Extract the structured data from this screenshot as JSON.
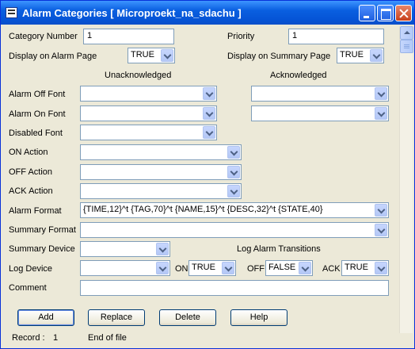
{
  "window": {
    "title": "Alarm Categories [ Microproekt_na_sdachu ]"
  },
  "form": {
    "category_number": {
      "label": "Category Number",
      "value": "1"
    },
    "priority": {
      "label": "Priority",
      "value": "1"
    },
    "display_on_alarm_page": {
      "label": "Display on Alarm Page",
      "value": "TRUE"
    },
    "display_on_summary_page": {
      "label": "Display on Summary Page",
      "value": "TRUE"
    },
    "headers": {
      "unacknowledged": "Unacknowledged",
      "acknowledged": "Acknowledged"
    },
    "alarm_off_font": {
      "label": "Alarm Off Font",
      "unack": "",
      "ack": ""
    },
    "alarm_on_font": {
      "label": "Alarm On Font",
      "unack": "",
      "ack": ""
    },
    "disabled_font": {
      "label": "Disabled Font",
      "value": ""
    },
    "on_action": {
      "label": "ON Action",
      "value": ""
    },
    "off_action": {
      "label": "OFF Action",
      "value": ""
    },
    "ack_action": {
      "label": "ACK Action",
      "value": ""
    },
    "alarm_format": {
      "label": "Alarm Format",
      "value": "{TIME,12}^t {TAG,70}^t {NAME,15}^t {DESC,32}^t {STATE,40}"
    },
    "summary_format": {
      "label": "Summary Format",
      "value": ""
    },
    "summary_device": {
      "label": "Summary Device",
      "value": ""
    },
    "log_alarm_transitions": {
      "label": "Log Alarm Transitions"
    },
    "log_device": {
      "label": "Log Device",
      "value": ""
    },
    "log_on": {
      "label": "ON",
      "value": "TRUE"
    },
    "log_off": {
      "label": "OFF",
      "value": "FALSE"
    },
    "log_ack": {
      "label": "ACK",
      "value": "TRUE"
    },
    "comment": {
      "label": "Comment",
      "value": ""
    }
  },
  "buttons": {
    "add": "Add",
    "replace": "Replace",
    "delete": "Delete",
    "help": "Help"
  },
  "status": {
    "record_label": "Record :",
    "record_number": "1",
    "message": "End of file"
  },
  "icons": {
    "app": "window-app-icon",
    "minimize": "minimize-icon",
    "maximize": "maximize-icon",
    "close": "close-icon",
    "dropdown": "chevron-down-icon",
    "scroll_up": "scroll-up-arrow-icon"
  },
  "colors": {
    "titlebar": "#0554d6",
    "window_bg": "#ece9d8",
    "field_border": "#7f9db9",
    "button_border": "#003c74"
  }
}
